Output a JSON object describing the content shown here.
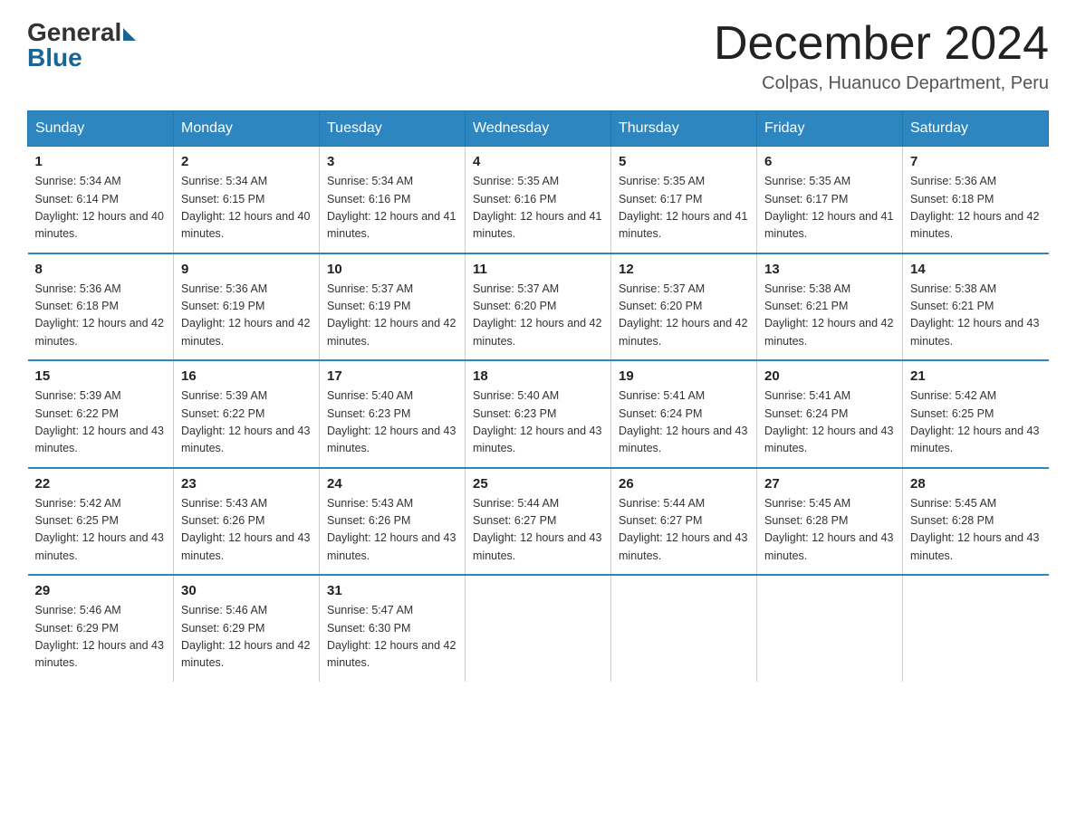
{
  "header": {
    "logo_general": "General",
    "logo_blue": "Blue",
    "month_title": "December 2024",
    "location": "Colpas, Huanuco Department, Peru"
  },
  "days_of_week": [
    "Sunday",
    "Monday",
    "Tuesday",
    "Wednesday",
    "Thursday",
    "Friday",
    "Saturday"
  ],
  "weeks": [
    [
      {
        "day": "1",
        "sunrise": "5:34 AM",
        "sunset": "6:14 PM",
        "daylight": "12 hours and 40 minutes."
      },
      {
        "day": "2",
        "sunrise": "5:34 AM",
        "sunset": "6:15 PM",
        "daylight": "12 hours and 40 minutes."
      },
      {
        "day": "3",
        "sunrise": "5:34 AM",
        "sunset": "6:16 PM",
        "daylight": "12 hours and 41 minutes."
      },
      {
        "day": "4",
        "sunrise": "5:35 AM",
        "sunset": "6:16 PM",
        "daylight": "12 hours and 41 minutes."
      },
      {
        "day": "5",
        "sunrise": "5:35 AM",
        "sunset": "6:17 PM",
        "daylight": "12 hours and 41 minutes."
      },
      {
        "day": "6",
        "sunrise": "5:35 AM",
        "sunset": "6:17 PM",
        "daylight": "12 hours and 41 minutes."
      },
      {
        "day": "7",
        "sunrise": "5:36 AM",
        "sunset": "6:18 PM",
        "daylight": "12 hours and 42 minutes."
      }
    ],
    [
      {
        "day": "8",
        "sunrise": "5:36 AM",
        "sunset": "6:18 PM",
        "daylight": "12 hours and 42 minutes."
      },
      {
        "day": "9",
        "sunrise": "5:36 AM",
        "sunset": "6:19 PM",
        "daylight": "12 hours and 42 minutes."
      },
      {
        "day": "10",
        "sunrise": "5:37 AM",
        "sunset": "6:19 PM",
        "daylight": "12 hours and 42 minutes."
      },
      {
        "day": "11",
        "sunrise": "5:37 AM",
        "sunset": "6:20 PM",
        "daylight": "12 hours and 42 minutes."
      },
      {
        "day": "12",
        "sunrise": "5:37 AM",
        "sunset": "6:20 PM",
        "daylight": "12 hours and 42 minutes."
      },
      {
        "day": "13",
        "sunrise": "5:38 AM",
        "sunset": "6:21 PM",
        "daylight": "12 hours and 42 minutes."
      },
      {
        "day": "14",
        "sunrise": "5:38 AM",
        "sunset": "6:21 PM",
        "daylight": "12 hours and 43 minutes."
      }
    ],
    [
      {
        "day": "15",
        "sunrise": "5:39 AM",
        "sunset": "6:22 PM",
        "daylight": "12 hours and 43 minutes."
      },
      {
        "day": "16",
        "sunrise": "5:39 AM",
        "sunset": "6:22 PM",
        "daylight": "12 hours and 43 minutes."
      },
      {
        "day": "17",
        "sunrise": "5:40 AM",
        "sunset": "6:23 PM",
        "daylight": "12 hours and 43 minutes."
      },
      {
        "day": "18",
        "sunrise": "5:40 AM",
        "sunset": "6:23 PM",
        "daylight": "12 hours and 43 minutes."
      },
      {
        "day": "19",
        "sunrise": "5:41 AM",
        "sunset": "6:24 PM",
        "daylight": "12 hours and 43 minutes."
      },
      {
        "day": "20",
        "sunrise": "5:41 AM",
        "sunset": "6:24 PM",
        "daylight": "12 hours and 43 minutes."
      },
      {
        "day": "21",
        "sunrise": "5:42 AM",
        "sunset": "6:25 PM",
        "daylight": "12 hours and 43 minutes."
      }
    ],
    [
      {
        "day": "22",
        "sunrise": "5:42 AM",
        "sunset": "6:25 PM",
        "daylight": "12 hours and 43 minutes."
      },
      {
        "day": "23",
        "sunrise": "5:43 AM",
        "sunset": "6:26 PM",
        "daylight": "12 hours and 43 minutes."
      },
      {
        "day": "24",
        "sunrise": "5:43 AM",
        "sunset": "6:26 PM",
        "daylight": "12 hours and 43 minutes."
      },
      {
        "day": "25",
        "sunrise": "5:44 AM",
        "sunset": "6:27 PM",
        "daylight": "12 hours and 43 minutes."
      },
      {
        "day": "26",
        "sunrise": "5:44 AM",
        "sunset": "6:27 PM",
        "daylight": "12 hours and 43 minutes."
      },
      {
        "day": "27",
        "sunrise": "5:45 AM",
        "sunset": "6:28 PM",
        "daylight": "12 hours and 43 minutes."
      },
      {
        "day": "28",
        "sunrise": "5:45 AM",
        "sunset": "6:28 PM",
        "daylight": "12 hours and 43 minutes."
      }
    ],
    [
      {
        "day": "29",
        "sunrise": "5:46 AM",
        "sunset": "6:29 PM",
        "daylight": "12 hours and 43 minutes."
      },
      {
        "day": "30",
        "sunrise": "5:46 AM",
        "sunset": "6:29 PM",
        "daylight": "12 hours and 42 minutes."
      },
      {
        "day": "31",
        "sunrise": "5:47 AM",
        "sunset": "6:30 PM",
        "daylight": "12 hours and 42 minutes."
      },
      null,
      null,
      null,
      null
    ]
  ],
  "labels": {
    "sunrise_prefix": "Sunrise: ",
    "sunset_prefix": "Sunset: ",
    "daylight_prefix": "Daylight: "
  }
}
